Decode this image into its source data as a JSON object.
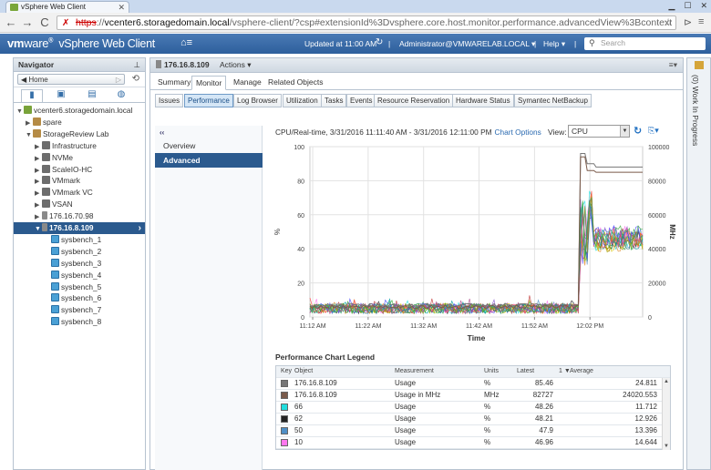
{
  "browser": {
    "tab_title": "vSphere Web Client",
    "url_scheme": "https",
    "url_sep": "://",
    "url_host": "vcenter6.storagedomain.local",
    "url_path": "/vsphere-client/?csp#extensionId%3Dvsphere.core.host.monitor.performance.advancedView%3Bcontext"
  },
  "header": {
    "brand_vm": "vm",
    "brand_ware": "ware",
    "app_name": "vSphere Web Client",
    "updated": "Updated at 11:00 AM",
    "user": "Administrator@VMWARELAB.LOCAL",
    "help": "Help",
    "search_placeholder": "Search"
  },
  "navigator": {
    "title": "Navigator",
    "home": "Home",
    "tree": [
      {
        "label": "vcenter6.storagedomain.local",
        "indent": 0,
        "twisty": "▼",
        "icon": "vc"
      },
      {
        "label": "spare",
        "indent": 1,
        "twisty": "▶",
        "icon": "dc"
      },
      {
        "label": "StorageReview Lab",
        "indent": 1,
        "twisty": "▼",
        "icon": "dc"
      },
      {
        "label": "Infrastructure",
        "indent": 2,
        "twisty": "▶",
        "icon": "cl"
      },
      {
        "label": "NVMe",
        "indent": 2,
        "twisty": "▶",
        "icon": "cl"
      },
      {
        "label": "ScaleIO-HC",
        "indent": 2,
        "twisty": "▶",
        "icon": "cl"
      },
      {
        "label": "VMmark",
        "indent": 2,
        "twisty": "▶",
        "icon": "cl"
      },
      {
        "label": "VMmark VC",
        "indent": 2,
        "twisty": "▶",
        "icon": "cl"
      },
      {
        "label": "VSAN",
        "indent": 2,
        "twisty": "▶",
        "icon": "cl"
      },
      {
        "label": "176.16.70.98",
        "indent": 2,
        "twisty": "▶",
        "icon": "host"
      },
      {
        "label": "176.16.8.109",
        "indent": 2,
        "twisty": "▼",
        "icon": "host",
        "selected": true
      },
      {
        "label": "sysbench_1",
        "indent": 3,
        "twisty": "",
        "icon": "vm"
      },
      {
        "label": "sysbench_2",
        "indent": 3,
        "twisty": "",
        "icon": "vm"
      },
      {
        "label": "sysbench_3",
        "indent": 3,
        "twisty": "",
        "icon": "vm"
      },
      {
        "label": "sysbench_4",
        "indent": 3,
        "twisty": "",
        "icon": "vm"
      },
      {
        "label": "sysbench_5",
        "indent": 3,
        "twisty": "",
        "icon": "vm"
      },
      {
        "label": "sysbench_6",
        "indent": 3,
        "twisty": "",
        "icon": "vm"
      },
      {
        "label": "sysbench_7",
        "indent": 3,
        "twisty": "",
        "icon": "vm"
      },
      {
        "label": "sysbench_8",
        "indent": 3,
        "twisty": "",
        "icon": "vm"
      }
    ]
  },
  "object": {
    "name": "176.16.8.109",
    "actions": "Actions"
  },
  "tabs": [
    "Summary",
    "Monitor",
    "Manage",
    "Related Objects"
  ],
  "subtabs": [
    "Issues",
    "Performance",
    "Log Browser",
    "Utilization",
    "Tasks",
    "Events",
    "Resource Reservation",
    "Hardware Status",
    "Symantec NetBackup"
  ],
  "perf_nav": {
    "collapse": "‹‹",
    "items": [
      "Overview",
      "Advanced"
    ]
  },
  "chart_header": {
    "title": "CPU/Real-time, 3/31/2016 11:11:40 AM - 3/31/2016 12:11:00 PM",
    "options_link": "Chart Options",
    "view_label": "View:",
    "view_value": "CPU"
  },
  "chart_data": {
    "type": "line",
    "title": "",
    "xlabel": "Time",
    "ylabel_left": "%",
    "ylabel_right": "MHz",
    "x_ticks": [
      "11:12 AM",
      "11:22 AM",
      "11:32 AM",
      "11:42 AM",
      "11:52 AM",
      "12:02 PM"
    ],
    "x_range_minutes": [
      0,
      60
    ],
    "y_left_ticks": [
      0,
      20,
      40,
      60,
      80,
      100
    ],
    "y_left_range": [
      0,
      100
    ],
    "y_right_ticks": [
      0,
      20000,
      40000,
      60000,
      80000,
      100000
    ],
    "y_right_range": [
      0,
      100000
    ],
    "grid": true,
    "series_summary": [
      {
        "name": "176.16.8.109",
        "measurement": "Usage",
        "latest": 85.46,
        "average": 24.811,
        "color": "#777777"
      },
      {
        "name": "176.16.8.109",
        "measurement": "Usage in MHz",
        "latest": 82727,
        "average": 24020.553,
        "color": "#7a5a4a"
      },
      {
        "name": "66",
        "measurement": "Usage",
        "latest": 48.26,
        "average": 11.712,
        "color": "#22dddd"
      },
      {
        "name": "62",
        "measurement": "Usage",
        "latest": 48.21,
        "average": 12.926,
        "color": "#222222"
      },
      {
        "name": "50",
        "measurement": "Usage",
        "latest": 47.9,
        "average": 13.396,
        "color": "#4f8fc6"
      },
      {
        "name": "10",
        "measurement": "Usage",
        "latest": 46.96,
        "average": 14.644,
        "color": "#ff77ee"
      }
    ]
  },
  "legend": {
    "title": "Performance Chart Legend",
    "columns": [
      "Key",
      "Object",
      "Measurement",
      "Units",
      "Latest",
      "Average"
    ],
    "sort_indicator": "1 ▼",
    "rows": [
      {
        "color": "#777777",
        "object": "176.16.8.109",
        "measurement": "Usage",
        "units": "%",
        "latest": "85.46",
        "average": "24.811"
      },
      {
        "color": "#7a5a4a",
        "object": "176.16.8.109",
        "measurement": "Usage in MHz",
        "units": "MHz",
        "latest": "82727",
        "average": "24020.553"
      },
      {
        "color": "#22dddd",
        "object": "66",
        "measurement": "Usage",
        "units": "%",
        "latest": "48.26",
        "average": "11.712"
      },
      {
        "color": "#222222",
        "object": "62",
        "measurement": "Usage",
        "units": "%",
        "latest": "48.21",
        "average": "12.926"
      },
      {
        "color": "#4f8fc6",
        "object": "50",
        "measurement": "Usage",
        "units": "%",
        "latest": "47.9",
        "average": "13.396"
      },
      {
        "color": "#ff77ee",
        "object": "10",
        "measurement": "Usage",
        "units": "%",
        "latest": "46.96",
        "average": "14.644"
      }
    ]
  },
  "work_in_progress": "(0) Work In Progress"
}
